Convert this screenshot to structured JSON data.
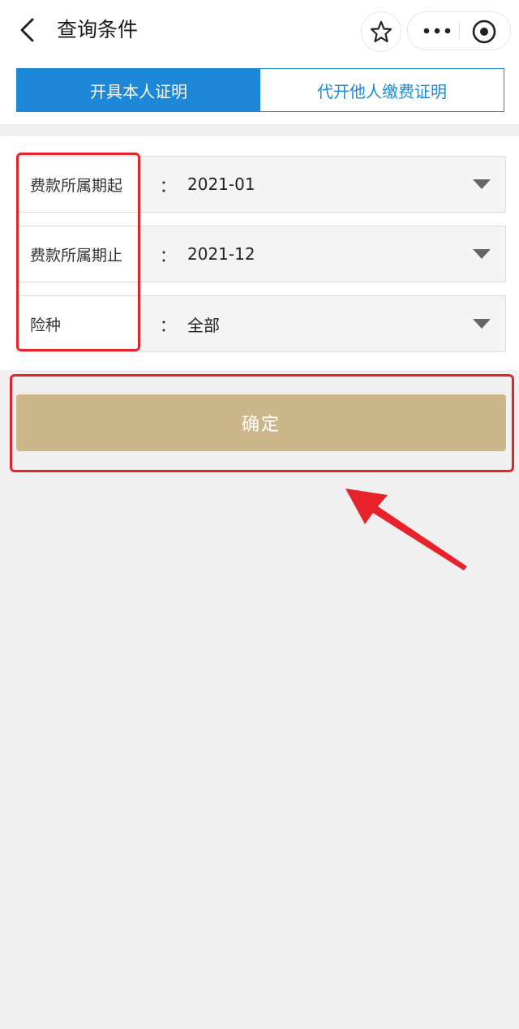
{
  "nav": {
    "title": "查询条件",
    "back_icon": "chevron-left-icon",
    "star_icon": "star-icon",
    "more_icon": "more-dots-icon",
    "close_icon": "target-icon"
  },
  "tabs": [
    {
      "label": "开具本人证明",
      "active": true
    },
    {
      "label": "代开他人缴费证明",
      "active": false
    }
  ],
  "form": {
    "colon": "：",
    "rows": [
      {
        "label": "费款所属期起",
        "value": "2021-01"
      },
      {
        "label": "费款所属期止",
        "value": "2021-12"
      },
      {
        "label": "险种",
        "value": "全部"
      }
    ]
  },
  "confirm_label": "确定",
  "colors": {
    "accent": "#1d88d8",
    "confirm": "#cbb789",
    "annotation": "#e8222a"
  }
}
